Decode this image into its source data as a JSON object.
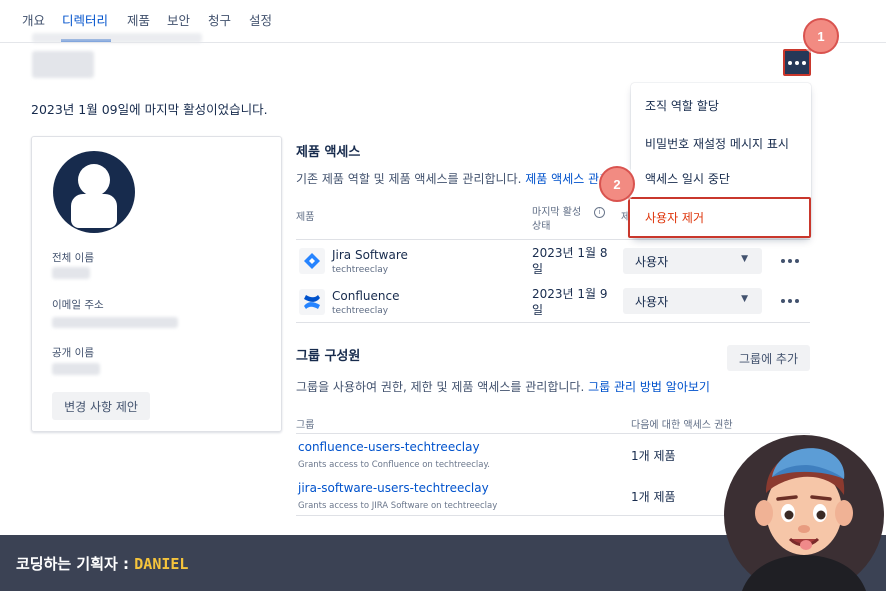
{
  "nav": {
    "tabs": [
      {
        "label": "개요"
      },
      {
        "label": "디렉터리"
      },
      {
        "label": "제품"
      },
      {
        "label": "보안"
      },
      {
        "label": "청구"
      },
      {
        "label": "설정"
      }
    ],
    "active_index": 1
  },
  "user": {
    "last_active": "2023년 1월 09일에 마지막 활성이었습니다."
  },
  "profile_card": {
    "full_name_label": "전체 이름",
    "email_label": "이메일 주소",
    "public_name_label": "공개 이름",
    "suggest_button": "변경 사항 제안"
  },
  "more_menu": {
    "items": [
      {
        "label": "조직 역할 할당"
      },
      {
        "label": "비밀번호 재설정 메시지 표시"
      },
      {
        "label": "액세스 일시 중단"
      },
      {
        "label": "사용자 제거"
      }
    ]
  },
  "callouts": [
    "1",
    "2"
  ],
  "product_access": {
    "title": "제품 액세스",
    "description": "기존 제품 역할 및 제품 액세스를 관리합니다.",
    "description_link": "제품 액세스 관리 방",
    "columns": {
      "product": "제품",
      "last_active": "마지막 활성 상태",
      "role_partial": "제"
    },
    "rows": [
      {
        "name": "Jira Software",
        "site": "techtreeclay",
        "last_active": "2023년 1월 8일",
        "role": "사용자",
        "icon": "jira-software-icon"
      },
      {
        "name": "Confluence",
        "site": "techtreeclay",
        "last_active": "2023년 1월 9일",
        "role": "사용자",
        "icon": "confluence-icon"
      }
    ]
  },
  "groups": {
    "title": "그룹 구성원",
    "add_button": "그룹에 추가",
    "description": "그룹을 사용하여 권한, 제한 및 제품 액세스를 관리합니다.",
    "description_link": "그룹 관리 방법 알아보기",
    "columns": {
      "group": "그룹",
      "access": "다음에 대한 액세스 권한"
    },
    "rows": [
      {
        "name": "confluence-users-techtreeclay",
        "desc": "Grants access to Confluence on techtreeclay.",
        "count": "1개 제품"
      },
      {
        "name": "jira-software-users-techtreeclay",
        "desc": "Grants access to JIRA Software on techtreeclay",
        "count": "1개 제품"
      }
    ]
  },
  "banner": {
    "prefix": "코딩하는 기획자 : ",
    "name": "DANIEL"
  },
  "colors": {
    "accent": "#0052cc",
    "danger": "#de350b",
    "callout": "#f28b82",
    "banner": "#3b4254",
    "banner_highlight": "#f5c43c"
  }
}
